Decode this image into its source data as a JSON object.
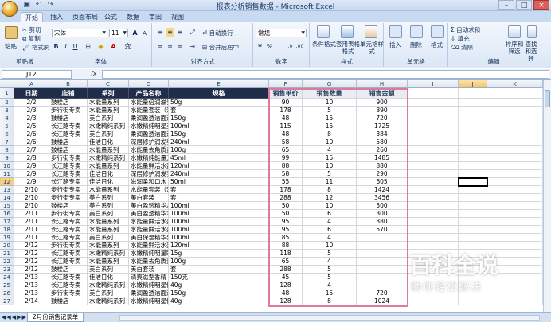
{
  "window": {
    "title": "报表分析销售数据 - Microsoft Excel",
    "qat": [
      "save-icon",
      "undo-icon",
      "redo-icon"
    ],
    "buttons": {
      "minimize": "–",
      "maximize": "□",
      "close": "×"
    }
  },
  "tabs": [
    "开始",
    "插入",
    "页面布局",
    "公式",
    "数据",
    "审阅",
    "视图"
  ],
  "ribbon": {
    "clipboard": {
      "paste": "粘贴",
      "cut": "剪切",
      "copy": "复制",
      "format_painter": "格式刷",
      "label": "剪贴板"
    },
    "font": {
      "name": "宋体",
      "size": "11",
      "label": "字体",
      "bold": "B",
      "italic": "I",
      "underline": "U",
      "grow": "A",
      "shrink": "A",
      "font_color": "A",
      "wen": "变"
    },
    "alignment": {
      "wrap": "自动换行",
      "merge": "合并后居中",
      "label": "对齐方式"
    },
    "number": {
      "format": "常规",
      "currency": "%",
      "percent": ",",
      "label": "数字"
    },
    "styles": {
      "conditional": "条件格式",
      "table": "套用表格格式",
      "cell_styles": "单元格样式",
      "label": "样式"
    },
    "cells": {
      "insert": "插入",
      "delete": "删除",
      "format": "格式",
      "label": "单元格"
    },
    "editing": {
      "autosum": "Σ 自动求和",
      "fill": "填充",
      "clear": "清除",
      "sort": "排序和筛选",
      "find": "查找和选择",
      "label": "编辑"
    }
  },
  "formula_bar": {
    "name_box": "J12",
    "fx": "fx",
    "value": ""
  },
  "columns": [
    "A",
    "B",
    "C",
    "D",
    "E",
    "F",
    "G",
    "H",
    "I",
    "J",
    "K"
  ],
  "table": {
    "headers": [
      "日期",
      "店铺",
      "系列",
      "产品名称",
      "规格",
      "销售单价",
      "销售数量",
      "销售金额"
    ],
    "rows": [
      [
        "2/2",
        "鼓楼店",
        "水能量系列",
        "水能量倍润滋养霜",
        "50g",
        "90",
        "10",
        "900"
      ],
      [
        "2/3",
        "步行街专卖",
        "水能量系列",
        "水能量套装（洁面+水+乳）",
        "套",
        "178",
        "5",
        "890"
      ],
      [
        "2/3",
        "鼓楼店",
        "美白系列",
        "柔润盈透洁面泡沫",
        "150g",
        "48",
        "15",
        "720"
      ],
      [
        "2/5",
        "长江路专卖",
        "水嫩精纯系列",
        "水嫩精纯明星美肌水",
        "100ml",
        "115",
        "15",
        "1725"
      ],
      [
        "2/6",
        "长江路专卖",
        "美白系列",
        "柔润盈透洁面泡沫",
        "150g",
        "48",
        "8",
        "384"
      ],
      [
        "2/6",
        "鼓楼店",
        "佳洁日化",
        "深层修护润发乳",
        "240ml",
        "58",
        "10",
        "580"
      ],
      [
        "2/7",
        "鼓楼店",
        "水能量系列",
        "水能量去角质素",
        "100g",
        "65",
        "4",
        "260"
      ],
      [
        "2/8",
        "步行街专卖",
        "水嫩精纯系列",
        "水嫩精纯能量元面霜",
        "45ml",
        "99",
        "15",
        "1485"
      ],
      [
        "2/9",
        "长江路专卖",
        "水能量系列",
        "水能量鲜活水盈润肤水",
        "120ml",
        "88",
        "10",
        "880"
      ],
      [
        "2/9",
        "长江路专卖",
        "佳洁日化",
        "深层修护润发乳",
        "240ml",
        "58",
        "5",
        "290"
      ],
      [
        "2/9",
        "长江路专卖",
        "佳洁日化",
        "滋润柔和口水",
        "50ml",
        "55",
        "11",
        "605"
      ],
      [
        "2/10",
        "步行街专卖",
        "水能量系列",
        "水能量套装（洁面+水+乳）",
        "套",
        "178",
        "8",
        "1424"
      ],
      [
        "2/10",
        "步行街专卖",
        "美白系列",
        "美白套装",
        "套",
        "288",
        "12",
        "3456"
      ],
      [
        "2/10",
        "鼓楼店",
        "美白系列",
        "美白盈透精华水",
        "100ml",
        "50",
        "10",
        "500"
      ],
      [
        "2/11",
        "步行街专卖",
        "美白系列",
        "美白盈透精华水",
        "100ml",
        "50",
        "6",
        "300"
      ],
      [
        "2/11",
        "长江路专卖",
        "水能量系列",
        "水能量鲜活水盈乳液",
        "100ml",
        "95",
        "4",
        "380"
      ],
      [
        "2/11",
        "长江路专卖",
        "水能量系列",
        "水能量鲜活水盈乳液",
        "100ml",
        "95",
        "6",
        "570"
      ],
      [
        "2/11",
        "长江路专卖",
        "美白系列",
        "美白保湿精华乳液",
        "100ml",
        "85",
        "4",
        ""
      ],
      [
        "2/12",
        "步行街专卖",
        "水能量系列",
        "水能量鲜活水盈润肤水",
        "120ml",
        "88",
        "10",
        ""
      ],
      [
        "2/12",
        "长江路专卖",
        "水嫩精纯系列",
        "水嫩精纯明星眼霜",
        "15g",
        "118",
        "5",
        ""
      ],
      [
        "2/12",
        "长江路专卖",
        "水能量系列",
        "水能量去角质素",
        "100g",
        "65",
        "4",
        ""
      ],
      [
        "2/12",
        "鼓楼店",
        "美白系列",
        "美白套装",
        "套",
        "288",
        "5",
        ""
      ],
      [
        "2/13",
        "长江路专卖",
        "佳洁日化",
        "清爽滋型香精",
        "150克",
        "45",
        "5",
        ""
      ],
      [
        "2/13",
        "长江路专卖",
        "水嫩精纯系列",
        "水嫩精纯明星修饰乳",
        "40g",
        "128",
        "4",
        ""
      ],
      [
        "2/13",
        "步行街专卖",
        "美白系列",
        "柔润盈透洁面泡沫",
        "150g",
        "48",
        "15",
        "720"
      ],
      [
        "2/14",
        "鼓楼店",
        "水嫩精纯系列",
        "水嫩精纯明星修饰乳",
        "40g",
        "128",
        "8",
        "1024"
      ]
    ],
    "row_numbers": [
      "1",
      "2",
      "3",
      "4",
      "5",
      "6",
      "7",
      "8",
      "9",
      "10",
      "11",
      "12",
      "13",
      "14",
      "15",
      "16",
      "17",
      "18",
      "19",
      "20",
      "21",
      "22",
      "23",
      "24",
      "25",
      "26",
      "27"
    ]
  },
  "sheet_tab": "2月份销售记录单",
  "watermark": {
    "big": "百科全说",
    "sub": "助你轻松解决"
  },
  "colors": {
    "header_bg": "#1f2d4a",
    "highlight": "#e07a9a",
    "selection": "#000000"
  }
}
